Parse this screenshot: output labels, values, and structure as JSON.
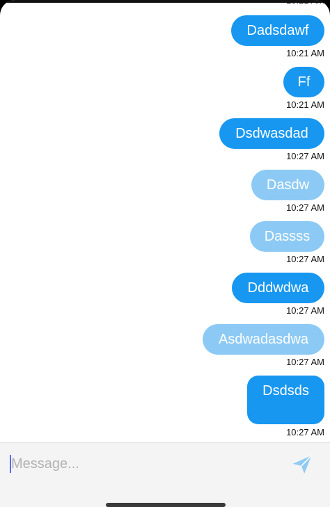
{
  "colors": {
    "sent_bubble": "#1797f0",
    "pending_bubble": "#8ccaf5",
    "background": "#ffffff",
    "input_bar": "#f4f4f4",
    "send_icon": "#8fcbf3"
  },
  "previous_time": "10:21 AM",
  "messages": [
    {
      "text": "Dadsdawf",
      "time": "10:21 AM",
      "status": "sent"
    },
    {
      "text": "Ff",
      "time": "10:21 AM",
      "status": "sent"
    },
    {
      "text": "Dsdwasdad",
      "time": "10:27 AM",
      "status": "sent"
    },
    {
      "text": "Dasdw",
      "time": "10:27 AM",
      "status": "pending"
    },
    {
      "text": "Dassss",
      "time": "10:27 AM",
      "status": "pending"
    },
    {
      "text": "Dddwdwa",
      "time": "10:27 AM",
      "status": "sent"
    },
    {
      "text": "Asdwadasdwa",
      "time": "10:27 AM",
      "status": "pending"
    },
    {
      "text": "Dsdsds",
      "time": "10:27 AM",
      "status": "sent"
    }
  ],
  "composer": {
    "placeholder": "Message...",
    "value": "",
    "send_icon": "send-icon"
  }
}
